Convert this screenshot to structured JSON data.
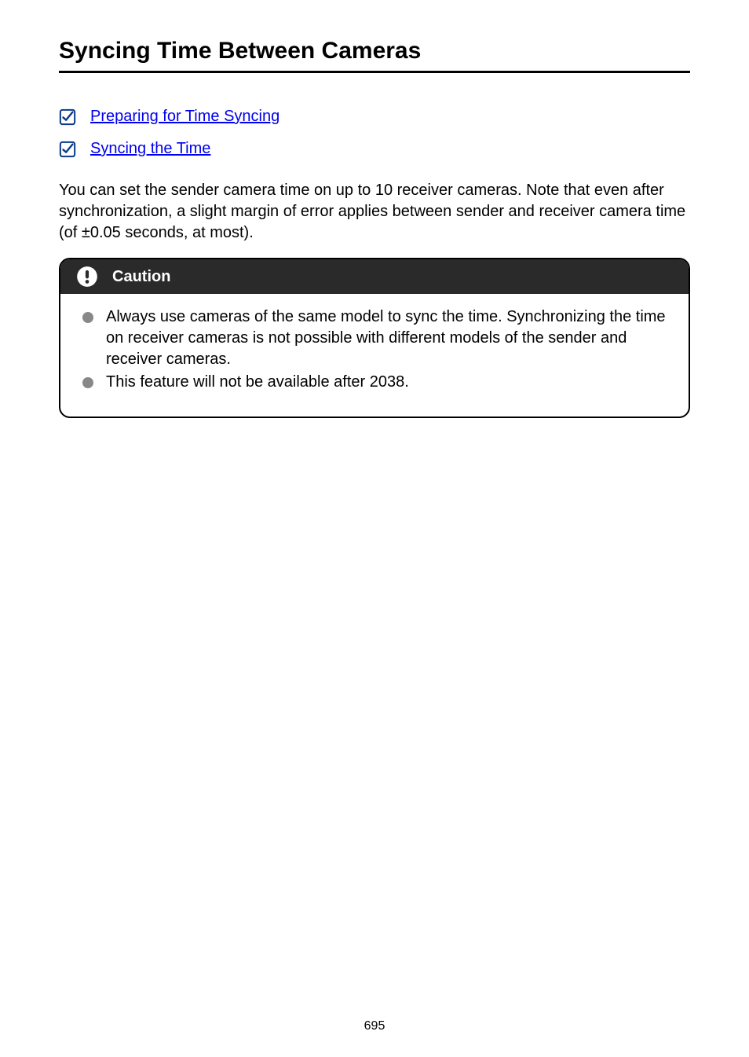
{
  "title": "Syncing Time Between Cameras",
  "links": {
    "prep": "Preparing for Time Syncing",
    "sync": "Syncing the Time"
  },
  "body": "You can set the sender camera time on up to 10 receiver cameras. Note that even after synchronization, a slight margin of error applies between sender and receiver camera time (of ±0.05 seconds, at most).",
  "caution": {
    "label": "Caution",
    "items": [
      "Always use cameras of the same model to sync the time. Synchronizing the time on receiver cameras is not possible with different models of the sender and receiver cameras.",
      "This feature will not be available after 2038."
    ]
  },
  "page_number": "695"
}
